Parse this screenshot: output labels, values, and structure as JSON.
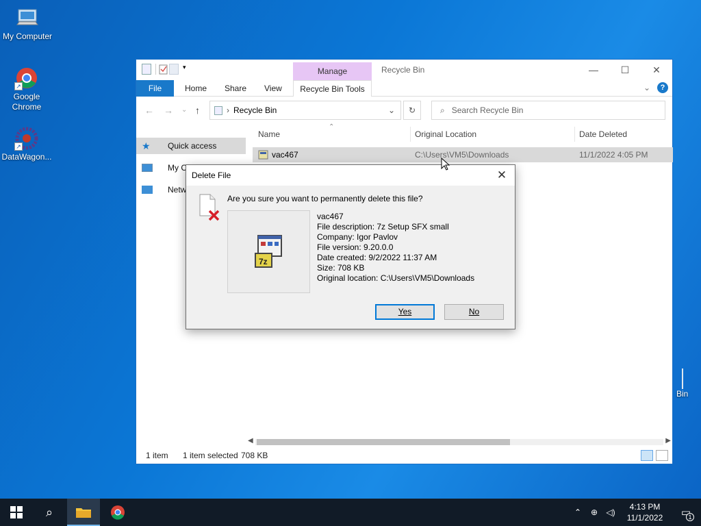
{
  "desktop": {
    "icons": [
      {
        "label": "My Computer",
        "icon": "computer-icon"
      },
      {
        "label": "Google Chrome",
        "icon": "chrome-icon"
      },
      {
        "label": "DataWagon...",
        "icon": "datawagon-icon"
      }
    ],
    "recycle_bin_partial_label": "Bin"
  },
  "explorer": {
    "contextual_tab": "Manage",
    "title": "Recycle Bin",
    "tabs": [
      "File",
      "Home",
      "Share",
      "View",
      "Recycle Bin Tools"
    ],
    "address": "Recycle Bin",
    "search_placeholder": "Search Recycle Bin",
    "nav_pane": [
      "Quick access",
      "My C",
      "Netw"
    ],
    "columns": [
      "Name",
      "Original Location",
      "Date Deleted"
    ],
    "file": {
      "name": "vac467",
      "original_location": "C:\\Users\\VM5\\Downloads",
      "date_deleted": "11/1/2022 4:05 PM"
    },
    "status": {
      "item_count": "1 item",
      "selection": "1 item selected",
      "size": "708 KB"
    }
  },
  "dialog": {
    "title": "Delete File",
    "question": "Are you sure you want to permanently delete this file?",
    "props": {
      "name": "vac467",
      "description": "File description: 7z Setup SFX small",
      "company": "Company: Igor Pavlov",
      "version": "File version: 9.20.0.0",
      "created": "Date created: 9/2/2022 11:37 AM",
      "size": "Size: 708 KB",
      "location": "Original location: C:\\Users\\VM5\\Downloads"
    },
    "yes_label": "Yes",
    "no_label": "No"
  },
  "taskbar": {
    "time": "4:13 PM",
    "date": "11/1/2022",
    "notification_count": "1"
  }
}
